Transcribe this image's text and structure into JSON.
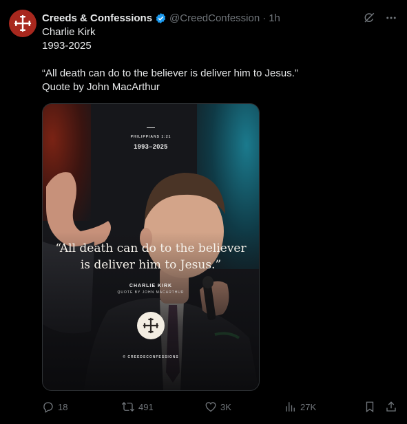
{
  "account": {
    "name": "Creeds & Confessions",
    "handle": "@CreedConfession",
    "separator": "·",
    "time": "1h"
  },
  "post": {
    "lines": [
      "Charlie Kirk",
      "1993-2025",
      "",
      "“All death can do to the believer is deliver him to Jesus.”",
      "Quote by John MacArthur"
    ]
  },
  "media": {
    "verse_ref": "PHILIPPIANS 1:21",
    "years": "1993–2025",
    "quote_line1": "“All death can do to the believer",
    "quote_line2": "is deliver him to Jesus.”",
    "attribution_name": "CHARLIE KIRK",
    "attribution_sub": "QUOTE BY JOHN MACARTHUR",
    "credit": "© CREEDSCONFESSIONS"
  },
  "actions": {
    "replies": "18",
    "reposts": "491",
    "likes": "3K",
    "views": "27K"
  },
  "colors": {
    "background": "#000000",
    "text": "#e7e9ea",
    "muted": "#71767b",
    "verified": "#1d9bf0",
    "avatar": "#a8281e"
  },
  "icons": [
    "cross-logo-icon",
    "verified-badge-icon",
    "grok-icon",
    "more-icon",
    "reply-icon",
    "repost-icon",
    "like-icon",
    "views-icon",
    "bookmark-icon",
    "share-icon"
  ]
}
